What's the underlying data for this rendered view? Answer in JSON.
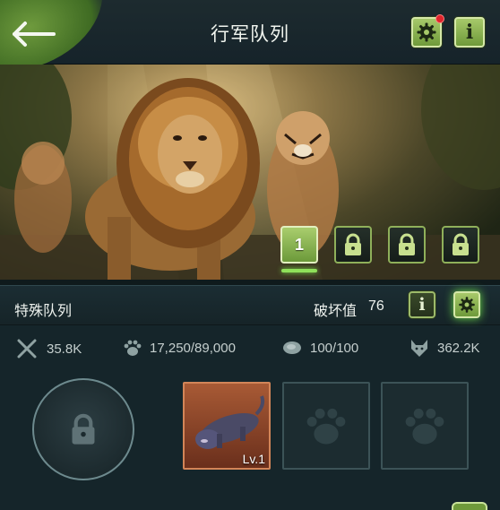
{
  "header": {
    "title": "行军队列",
    "settings_has_notification": true,
    "info_label": "i"
  },
  "queue_slots": [
    {
      "label": "1",
      "state": "active"
    },
    {
      "label": "",
      "state": "locked"
    },
    {
      "label": "",
      "state": "locked"
    },
    {
      "label": "",
      "state": "locked"
    }
  ],
  "panel": {
    "queue_name": "特殊队列",
    "damage_label": "破坏值",
    "damage_value": "76",
    "info_label": "i"
  },
  "stats": {
    "attack": "35.8K",
    "paw_capacity": "17,250/89,000",
    "stamina": "100/100",
    "power": "362.2K"
  },
  "pets": [
    {
      "level": "Lv.1",
      "animal": "panther",
      "state": "filled"
    },
    {
      "state": "empty"
    },
    {
      "state": "empty"
    }
  ],
  "colors": {
    "accent_green": "#8fb05a",
    "panel_bg": "#15252a",
    "notification_red": "#e0242b"
  }
}
